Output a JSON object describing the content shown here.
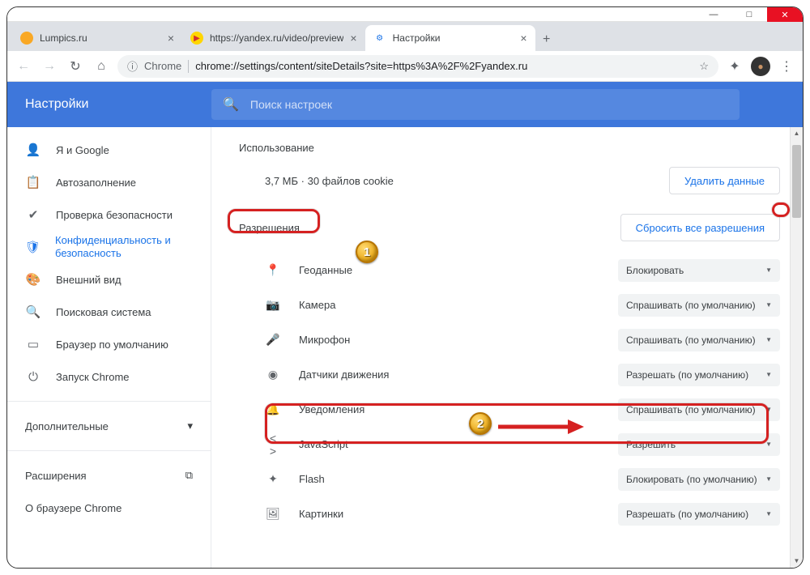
{
  "window": {
    "min": "—",
    "max": "□",
    "close": "✕"
  },
  "tabs": [
    {
      "title": "Lumpics.ru",
      "favicon_bg": "#f9a825",
      "favicon_char": ""
    },
    {
      "title": "https://yandex.ru/video/preview",
      "favicon_bg": "#ffd600",
      "favicon_char": "▶"
    },
    {
      "title": "Настройки",
      "favicon_bg": "#1a73e8",
      "favicon_char": "✿"
    }
  ],
  "addressbar": {
    "chrome_label": "Chrome",
    "url": "chrome://settings/content/siteDetails?site=https%3A%2F%2Fyandex.ru",
    "lock": "ⓘ"
  },
  "settings_header": {
    "title": "Настройки",
    "search_placeholder": "Поиск настроек"
  },
  "sidebar": {
    "items": [
      {
        "icon": "👤",
        "label": "Я и Google"
      },
      {
        "icon": "📋",
        "label": "Автозаполнение"
      },
      {
        "icon": "✔",
        "label": "Проверка безопасности"
      },
      {
        "icon": "🛡",
        "label": "Конфиденциальность и безопасность"
      },
      {
        "icon": "🎨",
        "label": "Внешний вид"
      },
      {
        "icon": "🔍",
        "label": "Поисковая система"
      },
      {
        "icon": "▭",
        "label": "Браузер по умолчанию"
      },
      {
        "icon": "⏻",
        "label": "Запуск Chrome"
      }
    ],
    "advanced": "Дополнительные",
    "extensions": "Расширения",
    "about": "О браузере Chrome"
  },
  "main": {
    "usage_title": "Использование",
    "usage_text": "3,7 МБ · 30 файлов cookie",
    "delete_btn": "Удалить данные",
    "perm_title": "Разрешения",
    "reset_btn": "Сбросить все разрешения",
    "permissions": [
      {
        "icon": "📍",
        "label": "Геоданные",
        "value": "Блокировать"
      },
      {
        "icon": "📷",
        "label": "Камера",
        "value": "Спрашивать (по умолчанию)"
      },
      {
        "icon": "🎤",
        "label": "Микрофон",
        "value": "Спрашивать (по умолчанию)"
      },
      {
        "icon": "◉",
        "label": "Датчики движения",
        "value": "Разрешать (по умолчанию)"
      },
      {
        "icon": "🔔",
        "label": "Уведомления",
        "value": "Спрашивать (по умолчанию)"
      },
      {
        "icon": "< >",
        "label": "JavaScript",
        "value": "Разрешить"
      },
      {
        "icon": "✦",
        "label": "Flash",
        "value": "Блокировать (по умолчанию)"
      },
      {
        "icon": "🖼",
        "label": "Картинки",
        "value": "Разрешать (по умолчанию)"
      }
    ]
  },
  "badges": {
    "one": "1",
    "two": "2"
  }
}
